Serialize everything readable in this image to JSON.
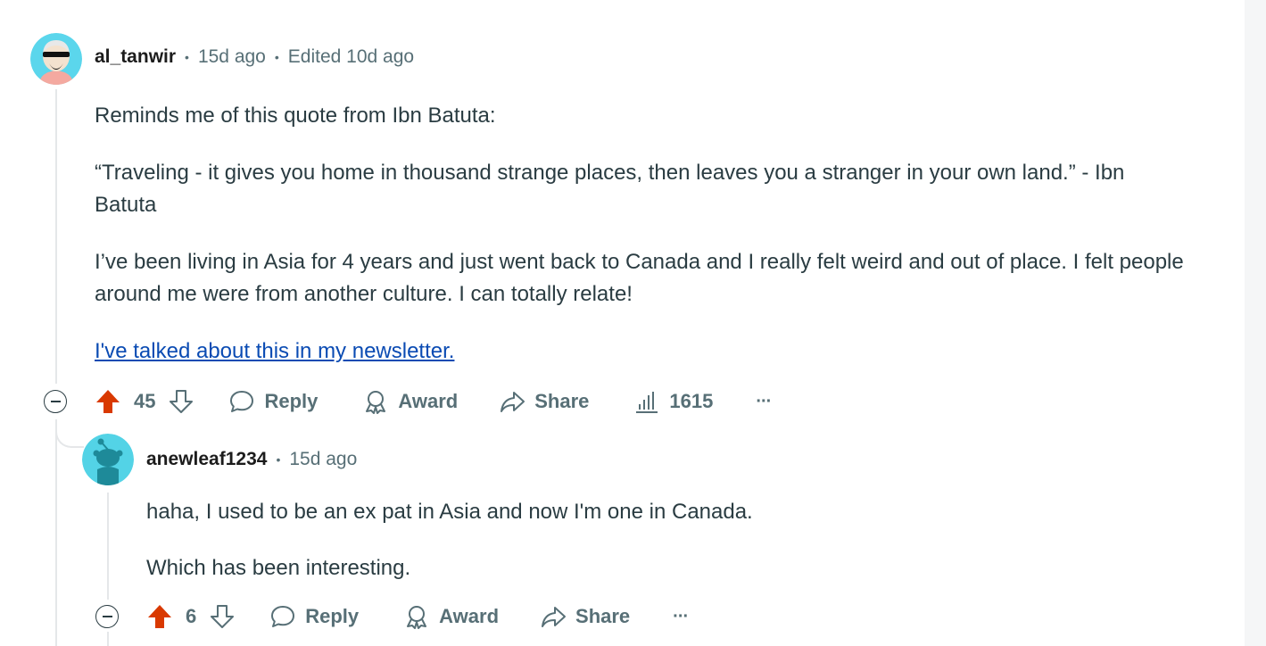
{
  "comment1": {
    "author": "al_tanwir",
    "posted": "15d ago",
    "edited": "Edited 10d ago",
    "paragraphs": [
      "Reminds me of this quote from Ibn Batuta:",
      "“Traveling - it gives you home in thousand strange places, then leaves you a stranger in your own land.” - Ibn Batuta",
      "I’ve been living in Asia for 4 years and just went back to Canada and I really felt weird and out of place. I felt people around me were from another culture. I can totally relate!"
    ],
    "link_text": "I've talked about this in my newsletter.",
    "votes": "45",
    "reply_label": "Reply",
    "award_label": "Award",
    "share_label": "Share",
    "views": "1615",
    "more_label": "···",
    "upvote_color": "#d93900"
  },
  "comment2": {
    "author": "anewleaf1234",
    "posted": "15d ago",
    "paragraphs": [
      "haha, I used to be an ex pat in Asia and now I'm one in Canada.",
      "Which has been interesting."
    ],
    "votes": "6",
    "reply_label": "Reply",
    "award_label": "Award",
    "share_label": "Share",
    "more_label": "···"
  }
}
